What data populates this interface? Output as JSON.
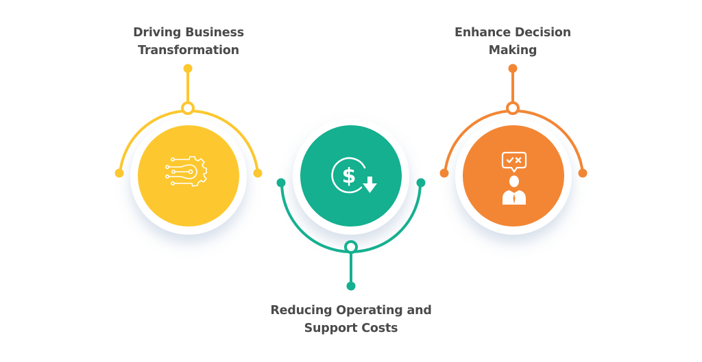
{
  "colors": {
    "yellow": "#FDC82F",
    "teal": "#14B08F",
    "orange": "#F38634",
    "text": "#4A4A4A",
    "ring": "#FFFFFF"
  },
  "items": [
    {
      "id": "driving-business-transformation",
      "label_lines": [
        "Driving Business",
        "Transformation"
      ],
      "color": "yellow",
      "icon": "gear-circuit-icon",
      "connector": "top"
    },
    {
      "id": "reducing-operating-and-support-costs",
      "label_lines": [
        "Reducing Operating and",
        "Support Costs"
      ],
      "color": "teal",
      "icon": "dollar-decrease-icon",
      "connector": "bottom"
    },
    {
      "id": "enhance-decision-making",
      "label_lines": [
        "Enhance Decision",
        "Making"
      ],
      "color": "orange",
      "icon": "decision-person-icon",
      "connector": "top"
    }
  ]
}
